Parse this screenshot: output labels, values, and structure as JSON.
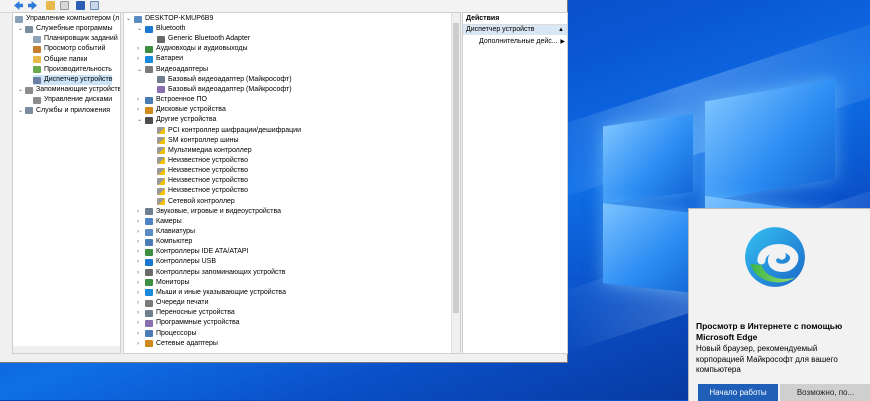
{
  "colors": {
    "selection": "#cce4f7",
    "accent": "#1f5fb8",
    "wallpaper": "#0a57d4"
  },
  "console_tree": {
    "root": "Управление компьютером (л",
    "items": [
      {
        "label": "Служебные программы",
        "indent": 1,
        "icon": "tools-icon"
      },
      {
        "label": "Планировщик заданий",
        "indent": 2,
        "icon": "clock-icon"
      },
      {
        "label": "Просмотр событий",
        "indent": 2,
        "icon": "event-viewer-icon"
      },
      {
        "label": "Общие папки",
        "indent": 2,
        "icon": "folder-icon"
      },
      {
        "label": "Производительность",
        "indent": 2,
        "icon": "performance-icon"
      },
      {
        "label": "Диспетчер устройств",
        "indent": 2,
        "icon": "device-manager-icon",
        "selected": true
      },
      {
        "label": "Запоминающие устройства",
        "indent": 1,
        "icon": "storage-icon"
      },
      {
        "label": "Управление дисками",
        "indent": 2,
        "icon": "disk-icon"
      },
      {
        "label": "Службы и приложения",
        "indent": 1,
        "icon": "services-icon"
      }
    ]
  },
  "device_tree": {
    "root": "DESKTOP-KMUP6B9",
    "items": [
      {
        "label": "Bluetooth",
        "level": 1,
        "expanded": true
      },
      {
        "label": "Generic Bluetooth Adapter",
        "level": 2
      },
      {
        "label": "Аудиовходы и аудиовыходы",
        "level": 1
      },
      {
        "label": "Батареи",
        "level": 1
      },
      {
        "label": "Видеоадаптеры",
        "level": 1,
        "expanded": true
      },
      {
        "label": "Базовый видеоадаптер (Майкрософт)",
        "level": 2
      },
      {
        "label": "Базовый видеоадаптер (Майкрософт)",
        "level": 2
      },
      {
        "label": "Встроенное ПО",
        "level": 1
      },
      {
        "label": "Дисковые устройства",
        "level": 1
      },
      {
        "label": "Другие устройства",
        "level": 1,
        "expanded": true
      },
      {
        "label": "PCI контроллер шифрации/дешифрации",
        "level": 2,
        "warn": true
      },
      {
        "label": "SM контроллер шины",
        "level": 2,
        "warn": true
      },
      {
        "label": "Мультимедиа контроллер",
        "level": 2,
        "warn": true
      },
      {
        "label": "Неизвестное устройство",
        "level": 2,
        "warn": true
      },
      {
        "label": "Неизвестное устройство",
        "level": 2,
        "warn": true
      },
      {
        "label": "Неизвестное устройство",
        "level": 2,
        "warn": true
      },
      {
        "label": "Неизвестное устройство",
        "level": 2,
        "warn": true
      },
      {
        "label": "Сетевой контроллер",
        "level": 2,
        "warn": true
      },
      {
        "label": "Звуковые, игровые и видеоустройства",
        "level": 1
      },
      {
        "label": "Камеры",
        "level": 1
      },
      {
        "label": "Клавиатуры",
        "level": 1
      },
      {
        "label": "Компьютер",
        "level": 1
      },
      {
        "label": "Контроллеры IDE ATA/ATAPI",
        "level": 1
      },
      {
        "label": "Контроллеры USB",
        "level": 1
      },
      {
        "label": "Контроллеры запоминающих устройств",
        "level": 1
      },
      {
        "label": "Мониторы",
        "level": 1
      },
      {
        "label": "Мыши и иные указывающие устройства",
        "level": 1
      },
      {
        "label": "Очереди печати",
        "level": 1
      },
      {
        "label": "Переносные устройства",
        "level": 1
      },
      {
        "label": "Программные устройства",
        "level": 1
      },
      {
        "label": "Процессоры",
        "level": 1
      },
      {
        "label": "Сетевые адаптеры",
        "level": 1
      }
    ]
  },
  "actions": {
    "title": "Действия",
    "section": "Диспетчер устройств",
    "more": "Дополнительные дейс..."
  },
  "toast": {
    "title": "Просмотр в Интернете с помощью Microsoft Edge",
    "body": "Новый браузер, рекомендуемый корпорацией Майкрософт для вашего компьютера",
    "primary": "Начало работы",
    "secondary": "Возможно, по..."
  }
}
